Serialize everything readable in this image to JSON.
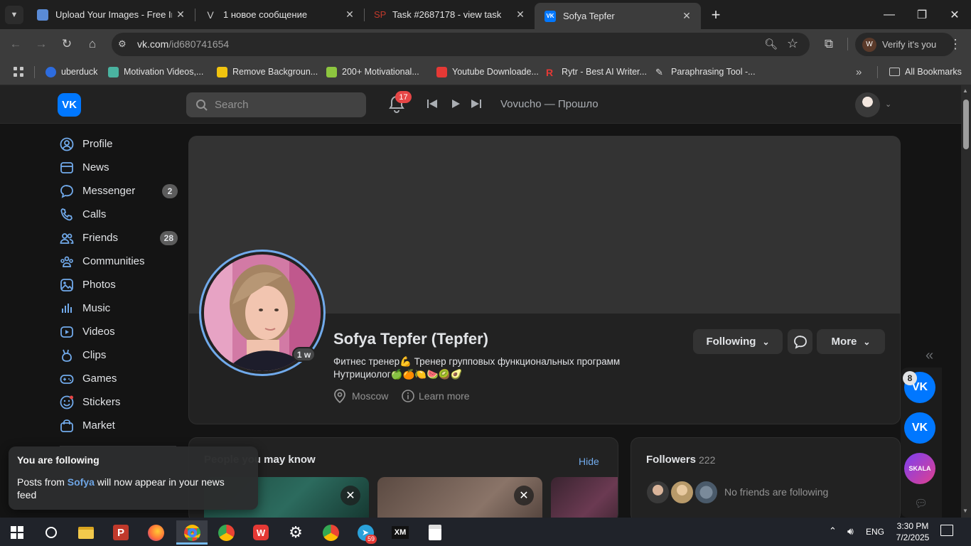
{
  "browser": {
    "tabs": [
      {
        "title": "Upload Your Images - Free Imag",
        "favicon_color": "#5a8bd6"
      },
      {
        "title": "1 новое сообщение",
        "favicon_color": "#1f1f1f"
      },
      {
        "title": "Task #2687178 - view task",
        "favicon_color": "#c0392b"
      },
      {
        "title": "Sofya Tepfer",
        "favicon_color": "#0077ff"
      }
    ],
    "active_tab": 3,
    "url_host": "vk.com",
    "url_path": "/id680741654",
    "verify_label": "Verify it's you",
    "verify_avatar_letter": "W",
    "bookmarks": [
      {
        "label": "uberduck",
        "color": "#2d6cdf"
      },
      {
        "label": "Motivation Videos,...",
        "color": "#4ab3a0"
      },
      {
        "label": "Remove Backgroun...",
        "color": "#f1c40f"
      },
      {
        "label": "200+ Motivational...",
        "color": "#8dc63f"
      },
      {
        "label": "Youtube Downloade...",
        "color": "#e53935"
      },
      {
        "label": "Rytr - Best AI Writer...",
        "color": "#e53935"
      },
      {
        "label": "Paraphrasing Tool -...",
        "color": "#d9d9d9"
      }
    ],
    "all_bookmarks_label": "All Bookmarks"
  },
  "vk": {
    "logo_text": "VK",
    "search_placeholder": "Search",
    "notifications_count": "17",
    "now_playing": "Vovucho — Прошло",
    "nav": [
      {
        "label": "Profile",
        "icon": "user-circle-icon",
        "count": ""
      },
      {
        "label": "News",
        "icon": "news-icon",
        "count": ""
      },
      {
        "label": "Messenger",
        "icon": "message-icon",
        "count": "2"
      },
      {
        "label": "Calls",
        "icon": "phone-icon",
        "count": ""
      },
      {
        "label": "Friends",
        "icon": "friends-icon",
        "count": "28"
      },
      {
        "label": "Communities",
        "icon": "communities-icon",
        "count": ""
      },
      {
        "label": "Photos",
        "icon": "photo-icon",
        "count": ""
      },
      {
        "label": "Music",
        "icon": "music-icon",
        "count": ""
      },
      {
        "label": "Videos",
        "icon": "video-icon",
        "count": ""
      },
      {
        "label": "Clips",
        "icon": "clips-icon",
        "count": ""
      },
      {
        "label": "Games",
        "icon": "gamepad-icon",
        "count": ""
      },
      {
        "label": "Stickers",
        "icon": "smile-icon",
        "count": ""
      },
      {
        "label": "Market",
        "icon": "bag-icon",
        "count": ""
      }
    ],
    "profile": {
      "name": "Sofya Tepfer (Tepfer)",
      "last_seen": "1 w",
      "bio_line1": "Фитнес тренер💪 Тренер групповых функциональных программ",
      "bio_line2": "Нутрициолог🍏🍊🍋🍉🥝🥑",
      "location": "Moscow",
      "learn_more": "Learn more",
      "following_label": "Following",
      "more_label": "More"
    },
    "people_you_may_know": {
      "title": "People you may know",
      "hide_label": "Hide"
    },
    "followers": {
      "title": "Followers",
      "count": "222",
      "note": "No friends are following"
    },
    "toast": {
      "title": "You are following",
      "body_prefix": "Posts from ",
      "body_name": "Sofya",
      "body_suffix": " will now appear in your news feed"
    },
    "mini_apps_badge": "8",
    "mini_app_skala_label": "SKALA"
  },
  "taskbar": {
    "lang": "ENG",
    "time": "3:30 PM",
    "date": "7/2/2025",
    "telegram_badge": "59"
  }
}
